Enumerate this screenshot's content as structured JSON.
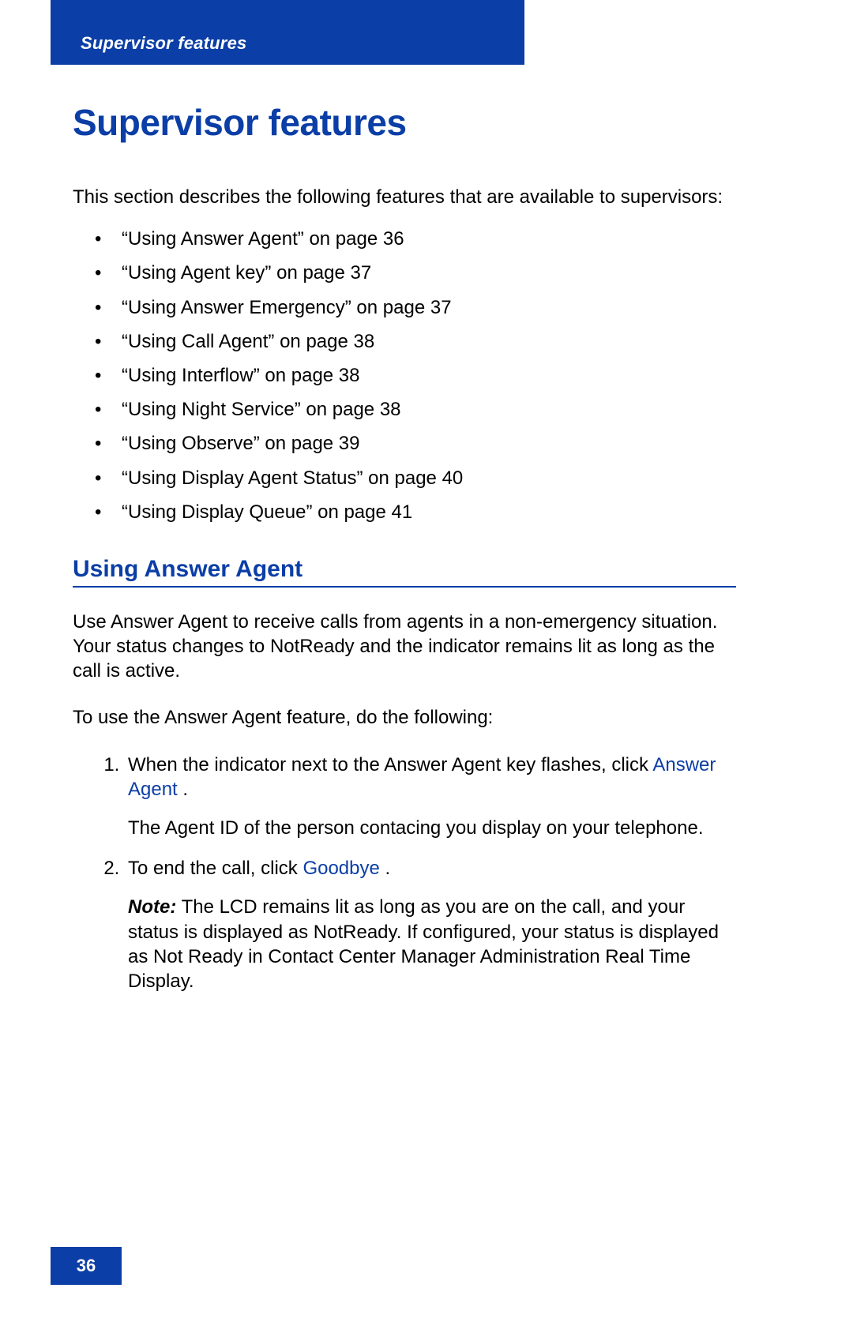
{
  "header": {
    "running_head": "Supervisor features"
  },
  "page": {
    "title": "Supervisor features",
    "intro": "This section describes the following features that are available to supervisors:",
    "toc_items": [
      "“Using Answer Agent” on page 36",
      "“Using Agent key” on page 37",
      "“Using Answer Emergency” on page 37",
      "“Using Call Agent” on page 38",
      "“Using Interflow” on page 38",
      "“Using Night Service” on page 38",
      "“Using Observe” on page 39",
      "“Using Display Agent Status” on page 40",
      "“Using Display Queue” on page 41"
    ],
    "section": {
      "heading": "Using Answer Agent",
      "desc": "Use Answer Agent to receive calls from agents in a non-emergency situation. Your status changes to NotReady and the indicator remains lit as long as the call is active.",
      "lead": "To use the Answer Agent feature, do the following:",
      "steps": {
        "s1": {
          "pre": "When the indicator next to the Answer Agent key flashes, click ",
          "link": "Answer Agent",
          "post": " .",
          "result": "The Agent ID of the person contacing you display on your telephone."
        },
        "s2": {
          "pre": "To end the call, click ",
          "link": "Goodbye",
          "post": " .",
          "note_label": "Note:",
          "note_body": " The LCD remains lit as long as you are on the call, and your status is displayed as NotReady. If configured, your status is displayed as Not Ready in Contact Center Manager Administration Real Time Display."
        }
      }
    }
  },
  "footer": {
    "page_number": "36"
  }
}
